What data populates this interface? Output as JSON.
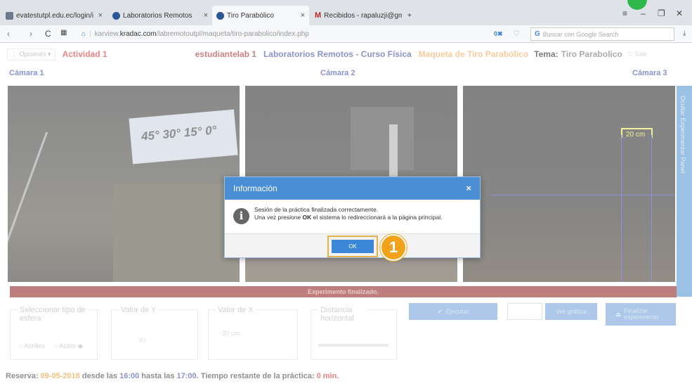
{
  "browser": {
    "tabs": [
      {
        "label": "evatestutpl.edu.ec/login/i",
        "color": "#6b7a8f"
      },
      {
        "label": "Laboratorios Remotos",
        "color": "#2b5797"
      },
      {
        "label": "Tiro Parabólico",
        "color": "#2b5797"
      },
      {
        "label": "Recibidos - rapaluzji@gm",
        "color": "#c5221f"
      }
    ],
    "new_tab": "+",
    "url_prefix": "karview.",
    "url_domain": "kradac.com",
    "url_path": "/labremotoutpl/maqueta/tiro-parabolico/index.php",
    "search_placeholder": "Buscar con Google Search",
    "badge": "0"
  },
  "header": {
    "options_label": "Opciones",
    "activity": "Actividad 1",
    "user": "estudiantelab 1",
    "course": "Laboratorios Remotos - Curso Física",
    "maqueta": "Maqueta de Tiro Parabólico",
    "tema_label": "Tema:",
    "tema_value": "Tiro Parabolico",
    "exit_label": "Salir"
  },
  "cameras": [
    {
      "label": "Cámara 1",
      "overlay": "45° 30° 15° 0°"
    },
    {
      "label": "Cámara 2"
    },
    {
      "label": "Cámara 3",
      "overlay": "20 cm"
    }
  ],
  "side_panel_label": "Ocultar Experimentar Panel",
  "status_bar": "Experimento finalizado.",
  "controls": {
    "sphere_legend": "Seleccionar tipo de esfera",
    "sphere_options": [
      "Acrílico",
      "Acero"
    ],
    "y_legend": "Valor de Y",
    "y_value": "Y=",
    "x_legend": "Valor de X",
    "x_value": "~20 cm.",
    "dist_legend": "Distancia horizontal",
    "execute_label": "Ejecutar",
    "plot_label": "Ver gráfica",
    "finish_label": "Finalizar experimento"
  },
  "reserva": {
    "prefix": "Reserva:",
    "date": "09-05-2018",
    "from_label": "desde las",
    "from_time": "16:00",
    "to_label": "hasta las",
    "to_time": "17:00.",
    "remaining_label": "Tiempo restante de la práctica:",
    "remaining_value": "0 min."
  },
  "modal": {
    "title": "Información",
    "close": "×",
    "line1": "Sesión de la práctica finalizada correctamente.",
    "line2_a": "Una vez presione",
    "line2_b": "OK",
    "line2_c": "el sistema lo redireccionará a la página principal.",
    "ok_label": "OK"
  },
  "step_badge": "1"
}
